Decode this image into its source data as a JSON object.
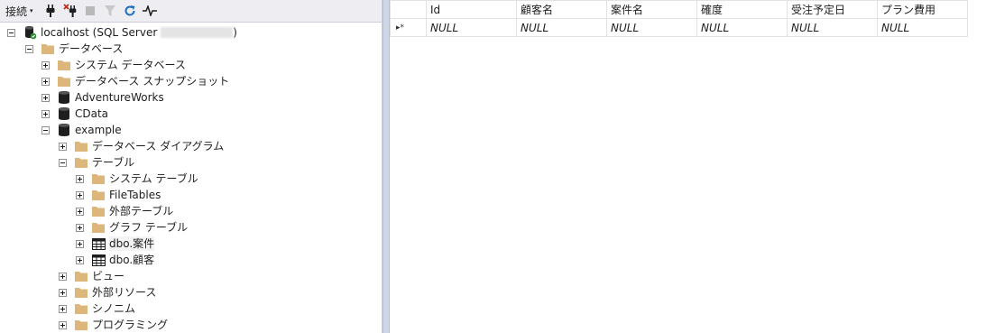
{
  "toolbar": {
    "connect_label": "接続",
    "caret": "▾",
    "buttons": [
      "connect-plug-icon",
      "disconnect-icon",
      "stop-icon",
      "filter-icon",
      "refresh-icon",
      "activity-monitor-icon"
    ]
  },
  "tree": {
    "server_label": "localhost (SQL Server",
    "server_suffix": ")",
    "databases": "データベース",
    "system_databases": "システム データベース",
    "snapshots": "データベース スナップショット",
    "db_adventureworks": "AdventureWorks",
    "db_cdata": "CData",
    "db_example": "example",
    "diagrams": "データベース ダイアグラム",
    "tables": "テーブル",
    "system_tables": "システム テーブル",
    "filetables": "FileTables",
    "external_tables": "外部テーブル",
    "graph_tables": "グラフ テーブル",
    "table_anken": "dbo.案件",
    "table_kokyaku": "dbo.顧客",
    "views": "ビュー",
    "external_resources": "外部リソース",
    "synonyms": "シノニム",
    "programmability": "プログラミング"
  },
  "grid": {
    "columns": [
      "Id",
      "顧客名",
      "案件名",
      "確度",
      "受注予定日",
      "プラン費用"
    ],
    "new_row_marker": "▸*",
    "rows": [
      [
        "NULL",
        "NULL",
        "NULL",
        "NULL",
        "NULL",
        "NULL"
      ]
    ]
  },
  "colors": {
    "toolbar_bg": "#eeeef2",
    "folder": "#dcb67a",
    "database": "#1e1e1e",
    "refresh": "#1e6fc0",
    "splitter": "#cfd6e5"
  }
}
